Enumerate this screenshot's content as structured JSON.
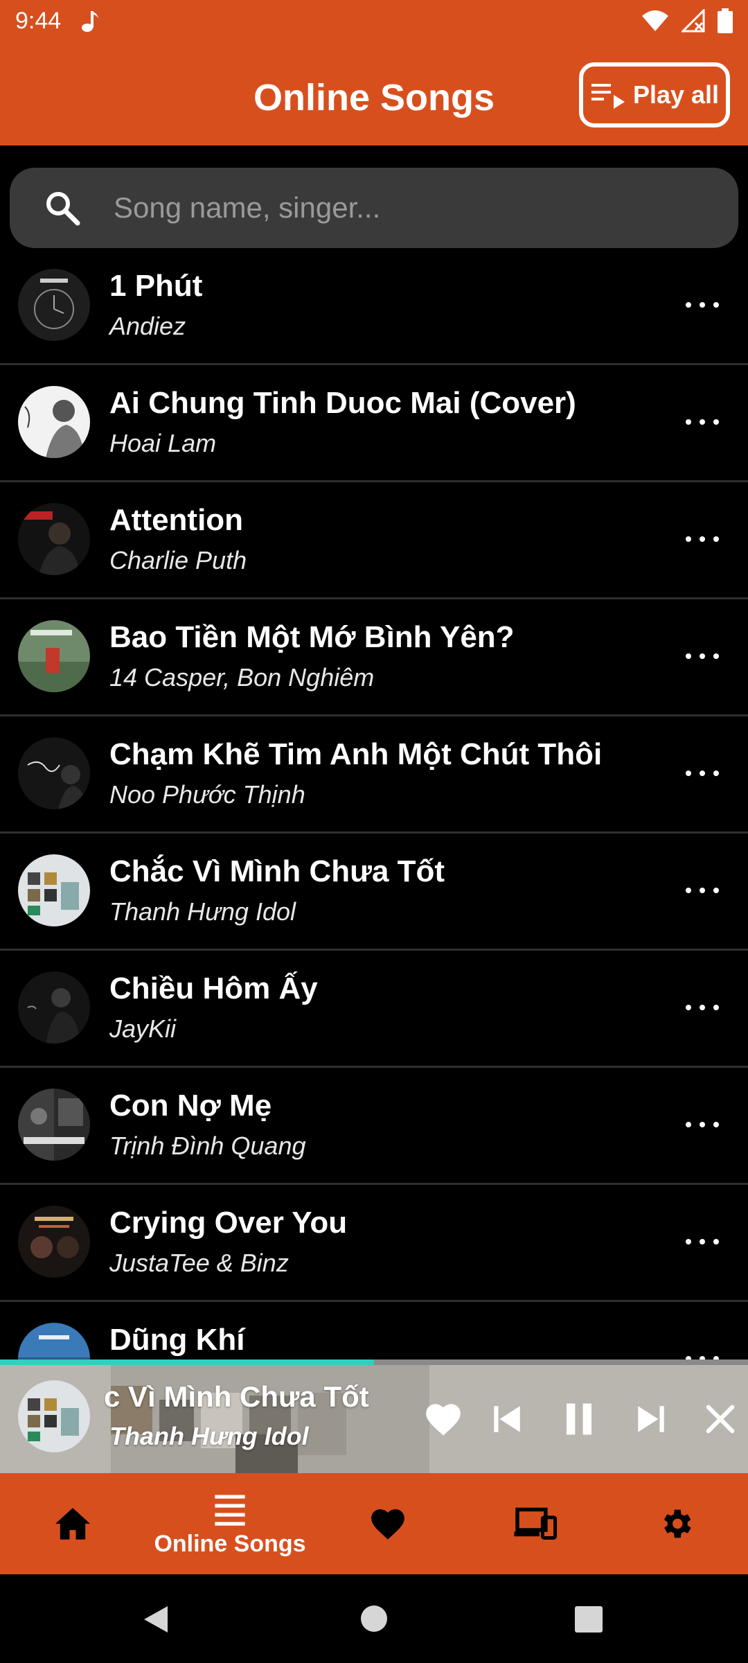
{
  "status_bar": {
    "time": "9:44"
  },
  "app_bar": {
    "title": "Online Songs",
    "play_all_label": "Play all"
  },
  "search": {
    "placeholder": "Song name, singer..."
  },
  "songs": [
    {
      "title": "1 Phút",
      "artist": "Andiez"
    },
    {
      "title": "Ai Chung Tinh Duoc Mai (Cover)",
      "artist": "Hoai Lam"
    },
    {
      "title": "Attention",
      "artist": "Charlie Puth"
    },
    {
      "title": "Bao Tiền Một Mớ Bình Yên?",
      "artist": "14 Casper, Bon Nghiêm"
    },
    {
      "title": "Chạm Khẽ Tim Anh Một Chút Thôi",
      "artist": "Noo Phước Thịnh"
    },
    {
      "title": "Chắc Vì Mình Chưa Tốt",
      "artist": "Thanh Hưng Idol"
    },
    {
      "title": "Chiều Hôm Ấy",
      "artist": "JayKii"
    },
    {
      "title": "Con Nợ Mẹ",
      "artist": "Trịnh Đình Quang"
    },
    {
      "title": "Crying Over You",
      "artist": "JustaTee & Binz"
    },
    {
      "title": "Dũng Khí",
      "artist": ""
    }
  ],
  "now_playing": {
    "title": "c Vì Mình Chưa Tốt",
    "artist": "Thanh Hưng Idol",
    "progress": 0.5
  },
  "bottom_nav": {
    "items": [
      {
        "icon": "home-icon",
        "label": ""
      },
      {
        "icon": "list-icon",
        "label": "Online Songs"
      },
      {
        "icon": "heart-icon",
        "label": ""
      },
      {
        "icon": "devices-icon",
        "label": ""
      },
      {
        "icon": "gear-icon",
        "label": ""
      }
    ]
  },
  "colors": {
    "accent": "#D84F1E",
    "progress": "#2fd0c0",
    "background": "#000000",
    "search_bg": "#3a3a3a"
  }
}
